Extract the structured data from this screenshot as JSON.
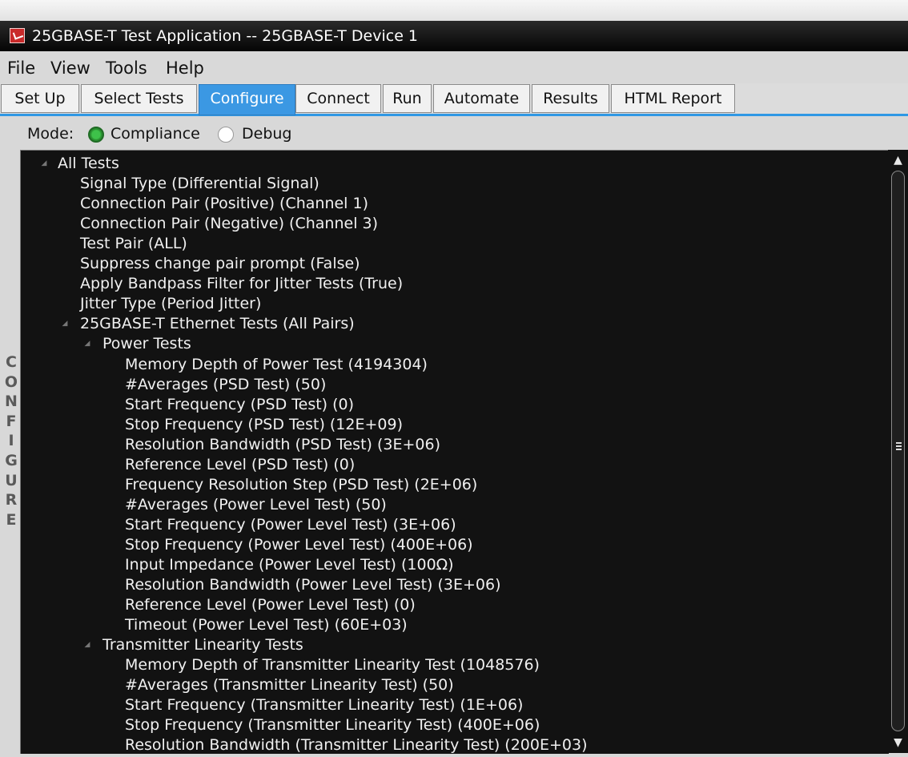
{
  "window": {
    "title": "25GBASE-T Test Application -- 25GBASE-T Device 1",
    "icon": "app-checkbox-icon"
  },
  "menu": [
    "File",
    "View",
    "Tools",
    "Help"
  ],
  "tabs": [
    {
      "label": "Set Up",
      "active": false
    },
    {
      "label": "Select Tests",
      "active": false
    },
    {
      "label": "Configure",
      "active": true
    },
    {
      "label": "Connect",
      "active": false
    },
    {
      "label": "Run",
      "active": false
    },
    {
      "label": "Automate",
      "active": false
    },
    {
      "label": "Results",
      "active": false
    },
    {
      "label": "HTML Report",
      "active": false
    }
  ],
  "side_label": "CONFIGURE",
  "mode": {
    "label": "Mode:",
    "options": [
      {
        "label": "Compliance",
        "selected": true
      },
      {
        "label": "Debug",
        "selected": false
      }
    ]
  },
  "tree": [
    {
      "text": "All Tests",
      "level": 0,
      "expandable": true
    },
    {
      "text": "Signal Type (Differential Signal)",
      "level": 1,
      "expandable": false
    },
    {
      "text": "Connection Pair (Positive) (Channel 1)",
      "level": 1,
      "expandable": false
    },
    {
      "text": "Connection Pair (Negative) (Channel 3)",
      "level": 1,
      "expandable": false
    },
    {
      "text": "Test Pair (ALL)",
      "level": 1,
      "expandable": false
    },
    {
      "text": "Suppress change pair prompt (False)",
      "level": 1,
      "expandable": false
    },
    {
      "text": "Apply Bandpass Filter for Jitter Tests (True)",
      "level": 1,
      "expandable": false
    },
    {
      "text": "Jitter Type (Period Jitter)",
      "level": 1,
      "expandable": false
    },
    {
      "text": "25GBASE-T Ethernet Tests (All Pairs)",
      "level": 1,
      "expandable": true
    },
    {
      "text": "Power Tests",
      "level": 2,
      "expandable": true
    },
    {
      "text": "Memory Depth of Power Test (4194304)",
      "level": 3,
      "expandable": false
    },
    {
      "text": "#Averages (PSD Test) (50)",
      "level": 3,
      "expandable": false
    },
    {
      "text": "Start Frequency (PSD Test) (0)",
      "level": 3,
      "expandable": false
    },
    {
      "text": "Stop Frequency (PSD Test) (12E+09)",
      "level": 3,
      "expandable": false
    },
    {
      "text": "Resolution Bandwidth (PSD Test) (3E+06)",
      "level": 3,
      "expandable": false
    },
    {
      "text": "Reference Level (PSD Test) (0)",
      "level": 3,
      "expandable": false
    },
    {
      "text": "Frequency Resolution Step (PSD Test) (2E+06)",
      "level": 3,
      "expandable": false
    },
    {
      "text": "#Averages (Power Level Test) (50)",
      "level": 3,
      "expandable": false
    },
    {
      "text": "Start Frequency (Power Level Test) (3E+06)",
      "level": 3,
      "expandable": false
    },
    {
      "text": "Stop Frequency (Power Level Test) (400E+06)",
      "level": 3,
      "expandable": false
    },
    {
      "text": "Input Impedance (Power Level Test) (100Ω)",
      "level": 3,
      "expandable": false
    },
    {
      "text": "Resolution Bandwidth (Power Level Test) (3E+06)",
      "level": 3,
      "expandable": false
    },
    {
      "text": "Reference Level (Power Level Test) (0)",
      "level": 3,
      "expandable": false
    },
    {
      "text": "Timeout (Power Level Test) (60E+03)",
      "level": 3,
      "expandable": false
    },
    {
      "text": "Transmitter Linearity Tests",
      "level": 2,
      "expandable": true
    },
    {
      "text": "Memory Depth of Transmitter Linearity Test (1048576)",
      "level": 3,
      "expandable": false
    },
    {
      "text": "#Averages (Transmitter Linearity Test) (50)",
      "level": 3,
      "expandable": false
    },
    {
      "text": "Start Frequency (Transmitter Linearity Test) (1E+06)",
      "level": 3,
      "expandable": false
    },
    {
      "text": "Stop Frequency (Transmitter Linearity Test) (400E+06)",
      "level": 3,
      "expandable": false
    },
    {
      "text": "Resolution Bandwidth (Transmitter Linearity Test) (200E+03)",
      "level": 3,
      "expandable": false
    }
  ],
  "scrollbar": {
    "up": "▲",
    "down": "▼"
  },
  "colors": {
    "accent": "#3b98e3",
    "tree_bg": "#121212",
    "radio_on": "#3ec24a"
  }
}
